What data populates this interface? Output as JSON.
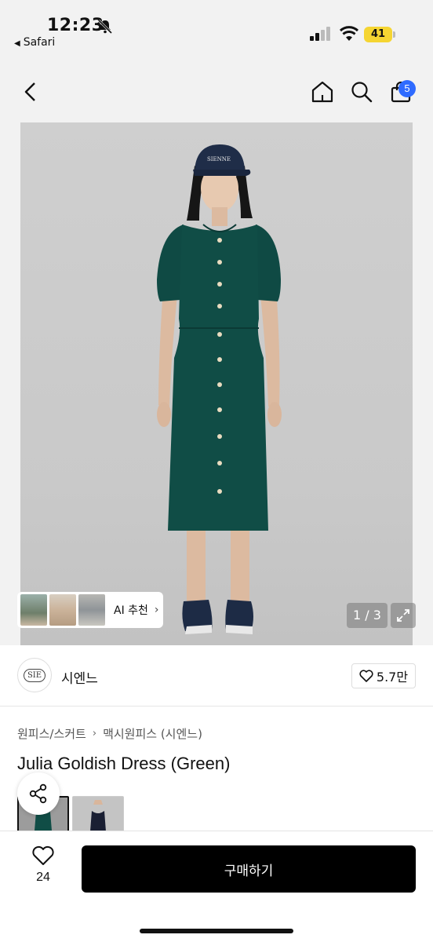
{
  "status_bar": {
    "time": "12:23",
    "back_app": "Safari",
    "battery": "41",
    "colors": {
      "battery": "#f5d532"
    }
  },
  "header": {
    "cart_badge": "5",
    "icons": [
      "back-arrow-icon",
      "home-icon",
      "search-icon",
      "shopping-bag-icon"
    ],
    "colors": {
      "badge": "#2f6bff"
    }
  },
  "hero": {
    "ai_chip_label": "AI 추천",
    "pager": "1 / 3"
  },
  "brand": {
    "name": "시엔느",
    "logo_text": "SIE",
    "likes": "5.7만"
  },
  "product": {
    "breadcrumb": [
      "원피스/스커트",
      "맥시원피스 (시엔느)"
    ],
    "title": "Julia Goldish Dress (Green)"
  },
  "bottom_bar": {
    "wish_count": "24",
    "buy_label": "구매하기"
  }
}
